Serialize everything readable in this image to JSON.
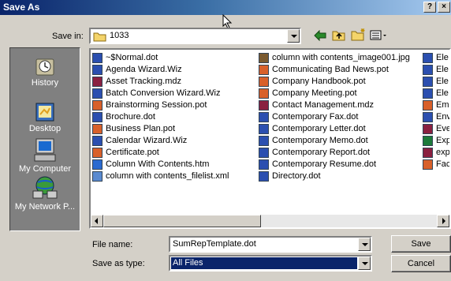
{
  "window": {
    "title": "Save As",
    "help_label": "?",
    "close_label": "×"
  },
  "toolbar": {
    "save_in_label": "Save in:",
    "current_folder": "1033"
  },
  "places": [
    {
      "label": "History",
      "icon": "history-icon"
    },
    {
      "label": "Desktop",
      "icon": "desktop-icon"
    },
    {
      "label": "My Computer",
      "icon": "my-computer-icon"
    },
    {
      "label": "My Network P...",
      "icon": "my-network-places-icon"
    }
  ],
  "files": {
    "col1": [
      {
        "name": "~$Normal.dot",
        "icon": "word-template-icon"
      },
      {
        "name": "Agenda Wizard.Wiz",
        "icon": "wizard-icon"
      },
      {
        "name": "Asset Tracking.mdz",
        "icon": "access-wizard-icon"
      },
      {
        "name": "Batch Conversion Wizard.Wiz",
        "icon": "wizard-icon"
      },
      {
        "name": "Brainstorming Session.pot",
        "icon": "powerpoint-template-icon"
      },
      {
        "name": "Brochure.dot",
        "icon": "word-template-icon"
      },
      {
        "name": "Business Plan.pot",
        "icon": "powerpoint-template-icon"
      },
      {
        "name": "Calendar Wizard.Wiz",
        "icon": "wizard-icon"
      },
      {
        "name": "Certificate.pot",
        "icon": "powerpoint-template-icon"
      },
      {
        "name": "Column With Contents.htm",
        "icon": "html-icon"
      },
      {
        "name": "column with contents_filelist.xml",
        "icon": "xml-icon"
      }
    ],
    "col2": [
      {
        "name": "column with contents_image001.jpg",
        "icon": "image-icon"
      },
      {
        "name": "Communicating Bad News.pot",
        "icon": "powerpoint-template-icon"
      },
      {
        "name": "Company Handbook.pot",
        "icon": "powerpoint-template-icon"
      },
      {
        "name": "Company Meeting.pot",
        "icon": "powerpoint-template-icon"
      },
      {
        "name": "Contact Management.mdz",
        "icon": "access-wizard-icon"
      },
      {
        "name": "Contemporary Fax.dot",
        "icon": "word-template-icon"
      },
      {
        "name": "Contemporary Letter.dot",
        "icon": "word-template-icon"
      },
      {
        "name": "Contemporary Memo.dot",
        "icon": "word-template-icon"
      },
      {
        "name": "Contemporary Report.dot",
        "icon": "word-template-icon"
      },
      {
        "name": "Contemporary Resume.dot",
        "icon": "word-template-icon"
      },
      {
        "name": "Directory.dot",
        "icon": "word-template-icon"
      }
    ],
    "col3": [
      {
        "name": "Ele",
        "icon": "word-template-icon"
      },
      {
        "name": "Ele",
        "icon": "word-template-icon"
      },
      {
        "name": "Ele",
        "icon": "word-template-icon"
      },
      {
        "name": "Ele",
        "icon": "word-template-icon"
      },
      {
        "name": "Emp",
        "icon": "powerpoint-template-icon"
      },
      {
        "name": "Env",
        "icon": "wizard-icon"
      },
      {
        "name": "Eve",
        "icon": "access-wizard-icon"
      },
      {
        "name": "Exp",
        "icon": "excel-template-icon"
      },
      {
        "name": "exp",
        "icon": "access-wizard-icon"
      },
      {
        "name": "Fac",
        "icon": "powerpoint-template-icon"
      }
    ]
  },
  "form": {
    "file_name_label": "File name:",
    "file_name_value": "SumRepTemplate.dot",
    "save_as_type_label": "Save as type:",
    "save_as_type_value": "All Files"
  },
  "buttons": {
    "save": "Save",
    "cancel": "Cancel"
  },
  "colors": {
    "titlebar_start": "#0a246a",
    "selection": "#0a246a",
    "word": "#2b4fb0",
    "powerpoint": "#d8602a",
    "access": "#8a2040",
    "excel": "#1c7a3a"
  }
}
